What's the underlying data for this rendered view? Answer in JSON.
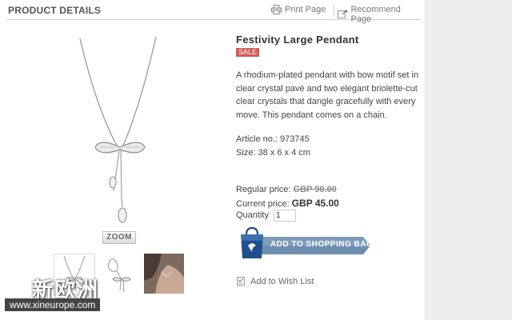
{
  "header": {
    "section_title": "PRODUCT DETAILS",
    "print_label": "Print Page",
    "recommend_label": "Recommend Page"
  },
  "gallery": {
    "zoom_label": "ZOOM",
    "thumbnails": [
      "necklace-front",
      "pendant-detail",
      "model-wearing"
    ]
  },
  "watermark": {
    "brand_text": "新欧洲",
    "url": "www.xineurope.com"
  },
  "product": {
    "title": "Festivity Large Pendant",
    "badge": "SALE",
    "description": "A rhodium-plated pendant with bow motif set in clear crystal pavé and two elegant briolette-cut clear crystals that dangle gracefully with every move. This pendant comes on a chain.",
    "article_label": "Article no.:",
    "article_no": "973745",
    "size_label": "Size:",
    "size": "38 x 6 x 4 cm",
    "regular_price_label": "Regular price:",
    "regular_price": "GBP 90.00",
    "current_price_label": "Current price:",
    "current_price": "GBP 45.00",
    "quantity_label": "Quantity",
    "quantity": "1",
    "add_to_bag_label": "ADD TO SHOPPING BAG",
    "wishlist_label": "Add to Wish List"
  },
  "colors": {
    "sale_badge": "#d35a5a",
    "cart_button": "#6e8fb0",
    "bag_blue": "#1f4f8c"
  }
}
